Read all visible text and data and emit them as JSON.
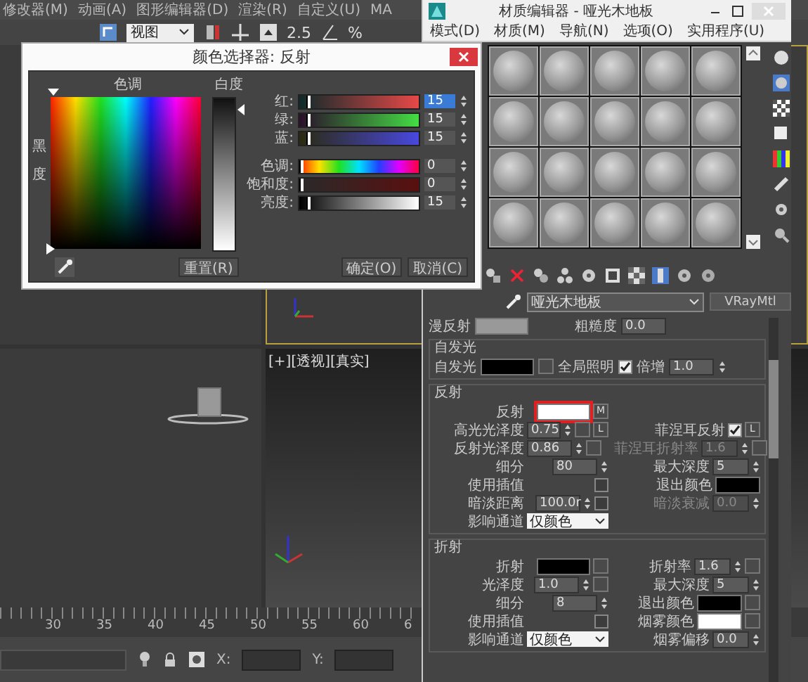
{
  "app": {
    "menu": [
      "修改器(M)",
      "动画(A)",
      "图形编辑器(D)",
      "渲染(R)",
      "自定义(U)",
      "MA"
    ],
    "toolbar": {
      "view": "视图",
      "angle_snap": "2.5",
      "percent_snap": "%"
    },
    "viewport_label": "[+][透视][真实]",
    "timeline_ticks": [
      "30",
      "35",
      "40",
      "45",
      "50",
      "55",
      "60",
      "6"
    ],
    "coords": [
      {
        "label": "X:"
      },
      {
        "label": "Y:"
      }
    ]
  },
  "color_picker": {
    "title": "颜色选择器: 反射",
    "hue_label": "色调",
    "whiteness_label": "白度",
    "blackness_label": "黑度",
    "channels": [
      {
        "kind": "red",
        "label": "红:",
        "value": "15",
        "level": 0.06,
        "highlighted": true
      },
      {
        "kind": "green",
        "label": "绿:",
        "value": "15",
        "level": 0.06,
        "highlighted": false
      },
      {
        "kind": "blue",
        "label": "蓝:",
        "value": "15",
        "level": 0.06,
        "highlighted": false
      },
      {
        "kind": "hue",
        "label": "色调:",
        "value": "0",
        "level": 0,
        "highlighted": false
      },
      {
        "kind": "saturation",
        "label": "饱和度:",
        "value": "0",
        "level": 0,
        "highlighted": false
      },
      {
        "kind": "value",
        "label": "亮度:",
        "value": "15",
        "level": 0.06,
        "highlighted": false
      }
    ],
    "reset": "重置(R)",
    "buttons": [
      "确定(O)",
      "取消(C)"
    ]
  },
  "material_editor": {
    "title": "材质编辑器 - 哑光木地板",
    "menu": [
      "模式(D)",
      "材质(M)",
      "导航(N)",
      "选项(O)",
      "实用程序(U)"
    ],
    "material_name": "哑光木地板",
    "material_type": "VRayMtl",
    "diffuse": {
      "label": "漫反射",
      "roughness_label": "粗糙度",
      "roughness": "0.0"
    },
    "self_illumination": {
      "title": "自发光",
      "label": "自发光",
      "color": "#000000",
      "gi_label": "全局照明",
      "gi_checked": true,
      "multiplier_label": "倍增",
      "multiplier": "1.0"
    },
    "groups": [
      {
        "title": "反射",
        "rows": [
          {
            "left": {
              "kind": "swatch",
              "label": "反射",
              "color": "#ffffff",
              "highlighted": true,
              "map_text": "M"
            }
          },
          {
            "left": {
              "kind": "spinner",
              "label": "高光光泽度",
              "value": "0.75",
              "disabled": false,
              "map_button": true,
              "lock": "L"
            },
            "right": {
              "kind": "checkbox",
              "label": "菲涅耳反射",
              "checked": true,
              "lock": "L"
            }
          },
          {
            "left": {
              "kind": "spinner",
              "label": "反射光泽度",
              "value": "0.86",
              "disabled": false,
              "map_button": true
            },
            "right": {
              "kind": "spinner",
              "label": "菲涅耳折射率",
              "value": "1.6",
              "disabled": true,
              "map_button": true
            }
          },
          {
            "left": {
              "kind": "spinner",
              "label": "细分",
              "value": "80",
              "disabled": false
            },
            "right": {
              "kind": "spinner",
              "label": "最大深度",
              "value": "5",
              "disabled": false
            }
          },
          {
            "left": {
              "kind": "checkbox",
              "label": "使用插值",
              "checked": false
            },
            "right": {
              "kind": "swatch",
              "label": "退出颜色",
              "color": "#000000",
              "highlighted": false
            }
          },
          {
            "left": {
              "kind": "spinner",
              "label": "暗淡距离",
              "value": "100.0r",
              "disabled": false,
              "toggle": {
                "checked": false
              }
            },
            "right": {
              "kind": "spinner",
              "label": "暗淡衰减",
              "value": "0.0",
              "disabled": true
            }
          },
          {
            "left": {
              "kind": "dropdown",
              "label": "影响通道",
              "value": "仅颜色"
            }
          }
        ]
      },
      {
        "title": "折射",
        "rows": [
          {
            "left": {
              "kind": "swatch",
              "label": "折射",
              "color": "#000000",
              "highlighted": false,
              "map_button": true
            },
            "right": {
              "kind": "spinner",
              "label": "折射率",
              "value": "1.6",
              "disabled": false,
              "map_button": true
            }
          },
          {
            "left": {
              "kind": "spinner",
              "label": "光泽度",
              "value": "1.0",
              "disabled": false,
              "map_button": true
            },
            "right": {
              "kind": "spinner",
              "label": "最大深度",
              "value": "5",
              "disabled": false
            }
          },
          {
            "left": {
              "kind": "spinner",
              "label": "细分",
              "value": "8",
              "disabled": false
            },
            "right": {
              "kind": "swatch",
              "label": "退出颜色",
              "color": "#000000",
              "highlighted": false,
              "map_button": true
            }
          },
          {
            "left": {
              "kind": "checkbox",
              "label": "使用插值",
              "checked": false
            },
            "right": {
              "kind": "swatch",
              "label": "烟雾颜色",
              "color": "#ffffff",
              "highlighted": false,
              "map_button": true
            }
          },
          {
            "left": {
              "kind": "dropdown",
              "label": "影响通道",
              "value": "仅颜色"
            },
            "right": {
              "kind": "spinner",
              "label": "烟雾偏移",
              "value": "0.0",
              "disabled": false
            }
          }
        ]
      }
    ]
  }
}
